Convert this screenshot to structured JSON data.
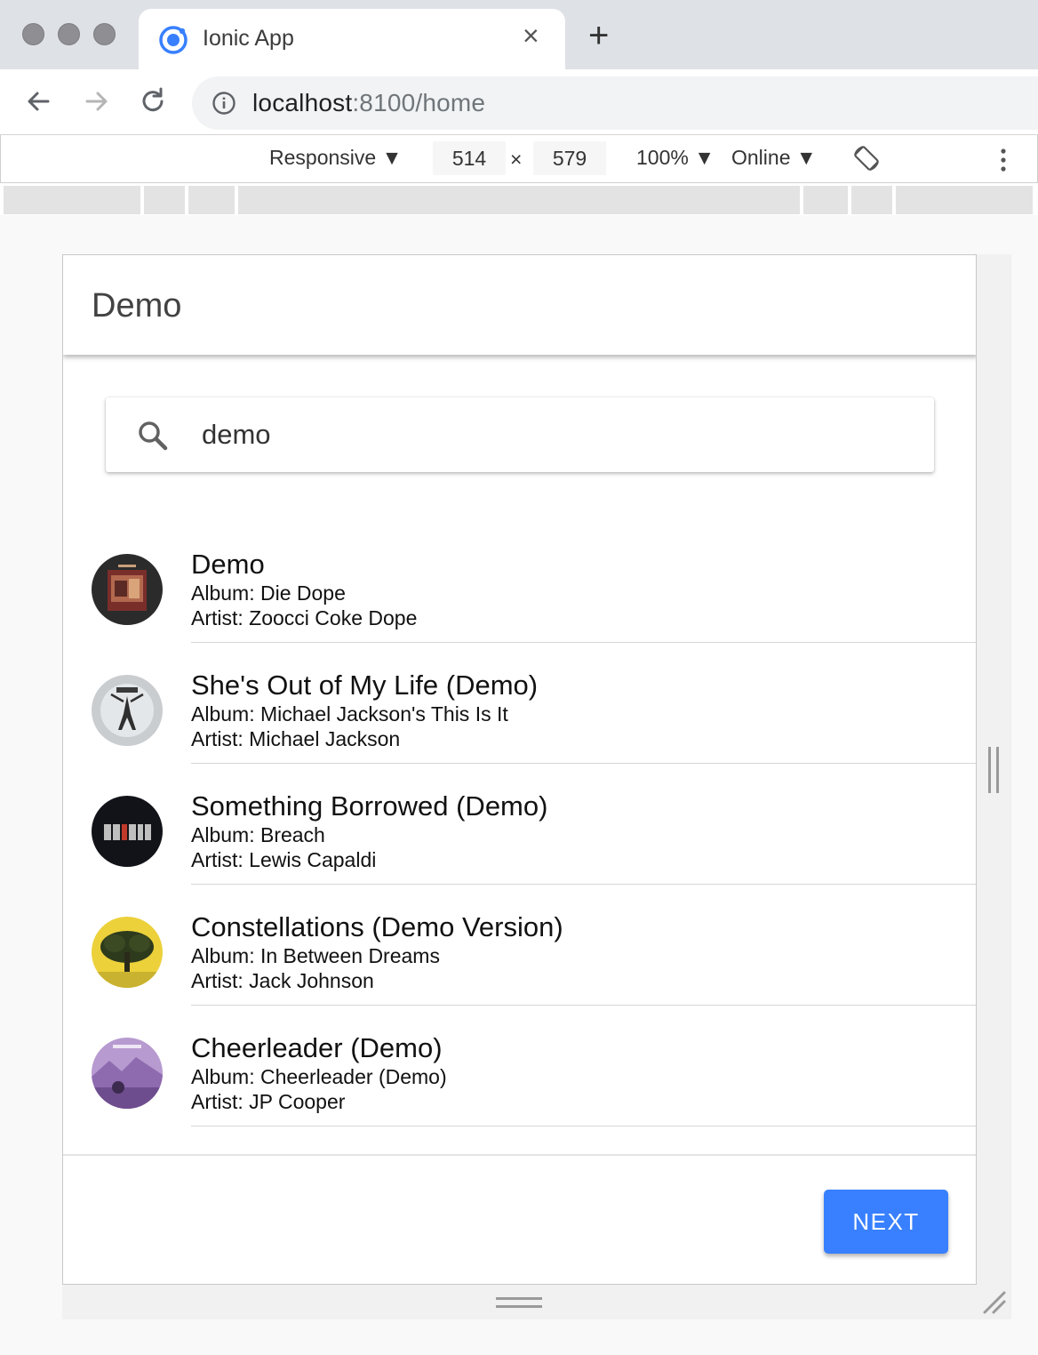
{
  "browser": {
    "tab_title": "Ionic App",
    "url_host": "localhost",
    "url_path": ":8100/home"
  },
  "devtools": {
    "device": "Responsive ▼",
    "width": "514",
    "times": "×",
    "height": "579",
    "zoom": "100% ▼",
    "network": "Online ▼"
  },
  "app": {
    "header_title": "Demo",
    "search": {
      "value": "demo"
    },
    "results": [
      {
        "title": "Demo",
        "album": "Album: Die Dope",
        "artist": "Artist: Zoocci Coke Dope"
      },
      {
        "title": "She's Out of My Life (Demo)",
        "album": "Album: Michael Jackson's This Is It",
        "artist": "Artist: Michael Jackson"
      },
      {
        "title": "Something Borrowed (Demo)",
        "album": "Album: Breach",
        "artist": "Artist: Lewis Capaldi"
      },
      {
        "title": "Constellations (Demo Version)",
        "album": "Album: In Between Dreams",
        "artist": "Artist: Jack Johnson"
      },
      {
        "title": "Cheerleader (Demo)",
        "album": "Album: Cheerleader (Demo)",
        "artist": "Artist: JP Cooper"
      }
    ],
    "next_label": "NEXT",
    "accent_color": "#3880ff"
  }
}
